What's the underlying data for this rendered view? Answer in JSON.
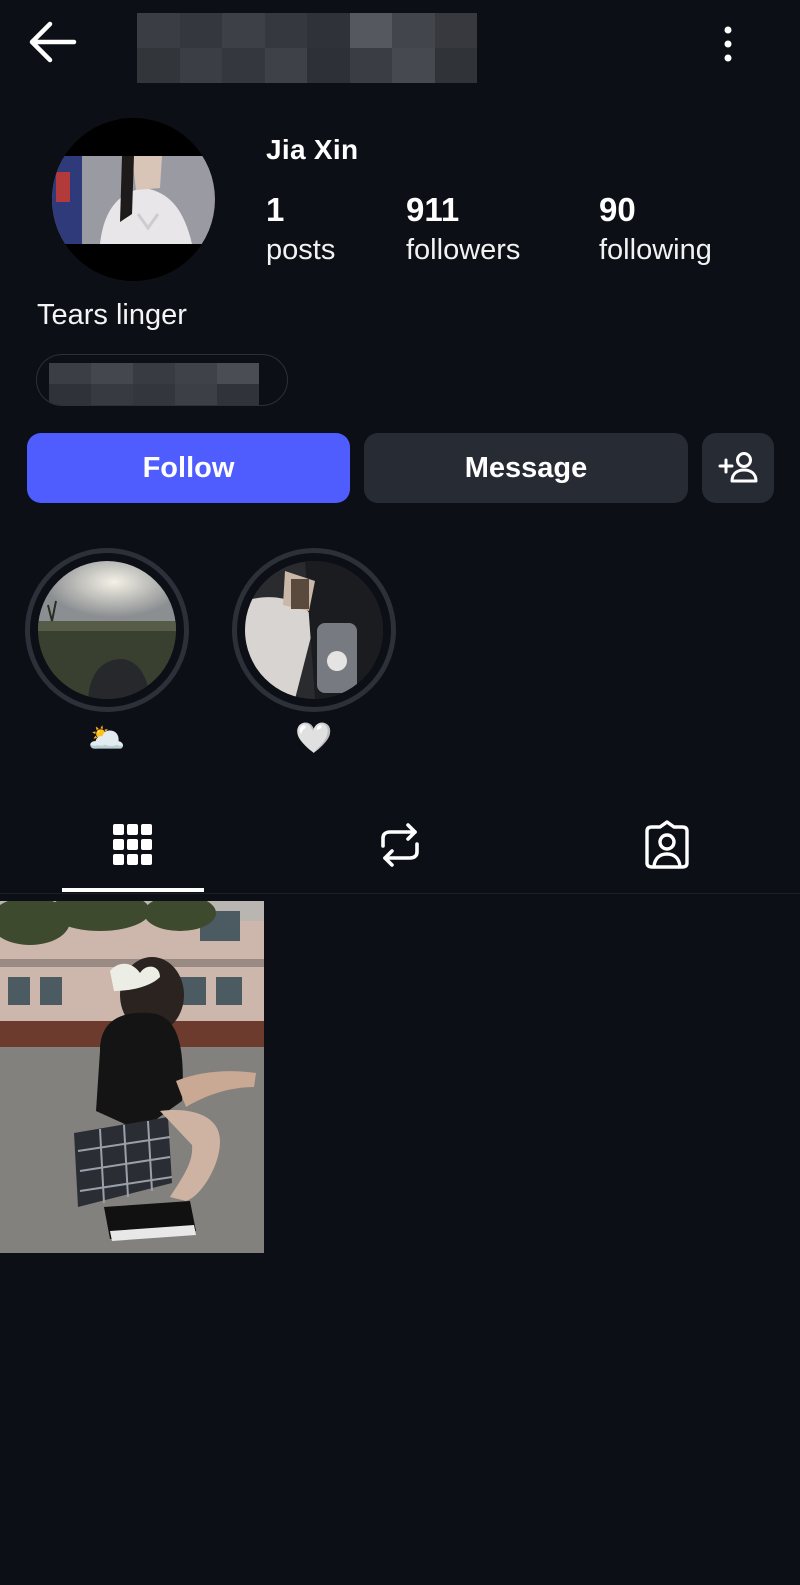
{
  "header": {
    "back_icon": "arrow-left-icon",
    "more_icon": "more-vertical-icon"
  },
  "profile": {
    "display_name": "Jia Xin",
    "bio": "Tears linger",
    "stats": [
      {
        "value": "1",
        "label": "posts"
      },
      {
        "value": "911",
        "label": "followers"
      },
      {
        "value": "90",
        "label": "following"
      }
    ]
  },
  "actions": {
    "follow_label": "Follow",
    "message_label": "Message",
    "add_user_icon": "add-person-icon"
  },
  "highlights": [
    {
      "label": "🌥️"
    },
    {
      "label": "🤍"
    }
  ],
  "tabs": [
    {
      "icon": "grid-icon",
      "selected": true
    },
    {
      "icon": "repost-icon",
      "selected": false
    },
    {
      "icon": "tagged-person-icon",
      "selected": false
    }
  ],
  "colors": {
    "background": "#0c0f16",
    "follow_button": "#4f5dff",
    "secondary_button": "#272b34"
  }
}
